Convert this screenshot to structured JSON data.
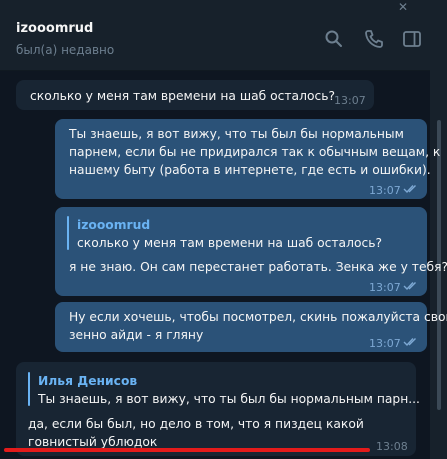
{
  "header": {
    "contact_name": "izooomrud",
    "last_seen": "был(а) недавно"
  },
  "icons": {
    "search": "search-icon",
    "call": "phone-icon",
    "sidebar": "sidebar-toggle-icon",
    "close": "close-icon"
  },
  "messages": [
    {
      "direction": "incoming",
      "text": "сколько у меня там времени на шаб осталось?",
      "time": "13:07"
    },
    {
      "direction": "outgoing",
      "lines": [
        "Ты знаешь, я вот вижу, что ты был бы нормальным",
        "парнем, если бы не придирался так к обычным вещам, к",
        "нашему быту (работа в интернете, где есть и ошибки)."
      ],
      "time": "13:07",
      "read": true
    },
    {
      "direction": "outgoing",
      "reply_to": {
        "name": "izooomrud",
        "text": "сколько у меня там времени на шаб осталось?"
      },
      "text": "я не знаю. Он сам перестанет работать. Зенка же у тебя?",
      "time": "13:07",
      "read": true
    },
    {
      "direction": "outgoing",
      "lines": [
        "Ну если хочешь, чтобы посмотрел, скинь пожалуйста свой",
        "зенно айди - я гляну"
      ],
      "time": "13:07",
      "read": true
    },
    {
      "direction": "incoming",
      "reply_to": {
        "name": "Илья Денисов",
        "text": "Ты знаешь, я вот вижу, что ты был бы нормальным парн..."
      },
      "lines": [
        "да, если бы был, но дело в том, что я пиздец какой",
        "говнистый ублюдок"
      ],
      "time": "13:08"
    }
  ],
  "colors": {
    "background": "#0e1621",
    "header": "#17212b",
    "incoming_bubble": "#182533",
    "outgoing_bubble": "#2b5278",
    "reply_accent_outgoing": "#6ab3f3",
    "reply_accent_incoming": "#6ab3f3",
    "annotation_underline": "#e31b1b"
  }
}
